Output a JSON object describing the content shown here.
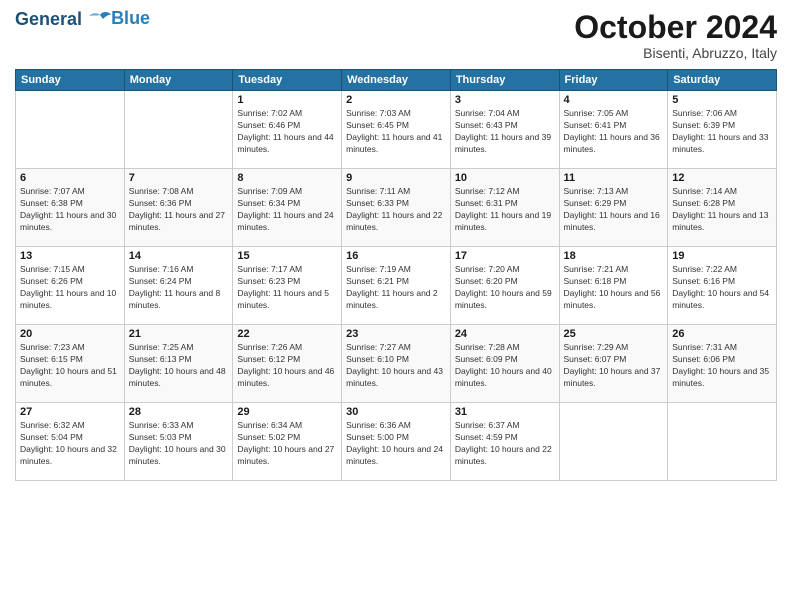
{
  "logo": {
    "line1": "General",
    "line2": "Blue"
  },
  "title": "October 2024",
  "location": "Bisenti, Abruzzo, Italy",
  "days_header": [
    "Sunday",
    "Monday",
    "Tuesday",
    "Wednesday",
    "Thursday",
    "Friday",
    "Saturday"
  ],
  "weeks": [
    [
      {
        "day": "",
        "sunrise": "",
        "sunset": "",
        "daylight": ""
      },
      {
        "day": "",
        "sunrise": "",
        "sunset": "",
        "daylight": ""
      },
      {
        "day": "1",
        "sunrise": "Sunrise: 7:02 AM",
        "sunset": "Sunset: 6:46 PM",
        "daylight": "Daylight: 11 hours and 44 minutes."
      },
      {
        "day": "2",
        "sunrise": "Sunrise: 7:03 AM",
        "sunset": "Sunset: 6:45 PM",
        "daylight": "Daylight: 11 hours and 41 minutes."
      },
      {
        "day": "3",
        "sunrise": "Sunrise: 7:04 AM",
        "sunset": "Sunset: 6:43 PM",
        "daylight": "Daylight: 11 hours and 39 minutes."
      },
      {
        "day": "4",
        "sunrise": "Sunrise: 7:05 AM",
        "sunset": "Sunset: 6:41 PM",
        "daylight": "Daylight: 11 hours and 36 minutes."
      },
      {
        "day": "5",
        "sunrise": "Sunrise: 7:06 AM",
        "sunset": "Sunset: 6:39 PM",
        "daylight": "Daylight: 11 hours and 33 minutes."
      }
    ],
    [
      {
        "day": "6",
        "sunrise": "Sunrise: 7:07 AM",
        "sunset": "Sunset: 6:38 PM",
        "daylight": "Daylight: 11 hours and 30 minutes."
      },
      {
        "day": "7",
        "sunrise": "Sunrise: 7:08 AM",
        "sunset": "Sunset: 6:36 PM",
        "daylight": "Daylight: 11 hours and 27 minutes."
      },
      {
        "day": "8",
        "sunrise": "Sunrise: 7:09 AM",
        "sunset": "Sunset: 6:34 PM",
        "daylight": "Daylight: 11 hours and 24 minutes."
      },
      {
        "day": "9",
        "sunrise": "Sunrise: 7:11 AM",
        "sunset": "Sunset: 6:33 PM",
        "daylight": "Daylight: 11 hours and 22 minutes."
      },
      {
        "day": "10",
        "sunrise": "Sunrise: 7:12 AM",
        "sunset": "Sunset: 6:31 PM",
        "daylight": "Daylight: 11 hours and 19 minutes."
      },
      {
        "day": "11",
        "sunrise": "Sunrise: 7:13 AM",
        "sunset": "Sunset: 6:29 PM",
        "daylight": "Daylight: 11 hours and 16 minutes."
      },
      {
        "day": "12",
        "sunrise": "Sunrise: 7:14 AM",
        "sunset": "Sunset: 6:28 PM",
        "daylight": "Daylight: 11 hours and 13 minutes."
      }
    ],
    [
      {
        "day": "13",
        "sunrise": "Sunrise: 7:15 AM",
        "sunset": "Sunset: 6:26 PM",
        "daylight": "Daylight: 11 hours and 10 minutes."
      },
      {
        "day": "14",
        "sunrise": "Sunrise: 7:16 AM",
        "sunset": "Sunset: 6:24 PM",
        "daylight": "Daylight: 11 hours and 8 minutes."
      },
      {
        "day": "15",
        "sunrise": "Sunrise: 7:17 AM",
        "sunset": "Sunset: 6:23 PM",
        "daylight": "Daylight: 11 hours and 5 minutes."
      },
      {
        "day": "16",
        "sunrise": "Sunrise: 7:19 AM",
        "sunset": "Sunset: 6:21 PM",
        "daylight": "Daylight: 11 hours and 2 minutes."
      },
      {
        "day": "17",
        "sunrise": "Sunrise: 7:20 AM",
        "sunset": "Sunset: 6:20 PM",
        "daylight": "Daylight: 10 hours and 59 minutes."
      },
      {
        "day": "18",
        "sunrise": "Sunrise: 7:21 AM",
        "sunset": "Sunset: 6:18 PM",
        "daylight": "Daylight: 10 hours and 56 minutes."
      },
      {
        "day": "19",
        "sunrise": "Sunrise: 7:22 AM",
        "sunset": "Sunset: 6:16 PM",
        "daylight": "Daylight: 10 hours and 54 minutes."
      }
    ],
    [
      {
        "day": "20",
        "sunrise": "Sunrise: 7:23 AM",
        "sunset": "Sunset: 6:15 PM",
        "daylight": "Daylight: 10 hours and 51 minutes."
      },
      {
        "day": "21",
        "sunrise": "Sunrise: 7:25 AM",
        "sunset": "Sunset: 6:13 PM",
        "daylight": "Daylight: 10 hours and 48 minutes."
      },
      {
        "day": "22",
        "sunrise": "Sunrise: 7:26 AM",
        "sunset": "Sunset: 6:12 PM",
        "daylight": "Daylight: 10 hours and 46 minutes."
      },
      {
        "day": "23",
        "sunrise": "Sunrise: 7:27 AM",
        "sunset": "Sunset: 6:10 PM",
        "daylight": "Daylight: 10 hours and 43 minutes."
      },
      {
        "day": "24",
        "sunrise": "Sunrise: 7:28 AM",
        "sunset": "Sunset: 6:09 PM",
        "daylight": "Daylight: 10 hours and 40 minutes."
      },
      {
        "day": "25",
        "sunrise": "Sunrise: 7:29 AM",
        "sunset": "Sunset: 6:07 PM",
        "daylight": "Daylight: 10 hours and 37 minutes."
      },
      {
        "day": "26",
        "sunrise": "Sunrise: 7:31 AM",
        "sunset": "Sunset: 6:06 PM",
        "daylight": "Daylight: 10 hours and 35 minutes."
      }
    ],
    [
      {
        "day": "27",
        "sunrise": "Sunrise: 6:32 AM",
        "sunset": "Sunset: 5:04 PM",
        "daylight": "Daylight: 10 hours and 32 minutes."
      },
      {
        "day": "28",
        "sunrise": "Sunrise: 6:33 AM",
        "sunset": "Sunset: 5:03 PM",
        "daylight": "Daylight: 10 hours and 30 minutes."
      },
      {
        "day": "29",
        "sunrise": "Sunrise: 6:34 AM",
        "sunset": "Sunset: 5:02 PM",
        "daylight": "Daylight: 10 hours and 27 minutes."
      },
      {
        "day": "30",
        "sunrise": "Sunrise: 6:36 AM",
        "sunset": "Sunset: 5:00 PM",
        "daylight": "Daylight: 10 hours and 24 minutes."
      },
      {
        "day": "31",
        "sunrise": "Sunrise: 6:37 AM",
        "sunset": "Sunset: 4:59 PM",
        "daylight": "Daylight: 10 hours and 22 minutes."
      },
      {
        "day": "",
        "sunrise": "",
        "sunset": "",
        "daylight": ""
      },
      {
        "day": "",
        "sunrise": "",
        "sunset": "",
        "daylight": ""
      }
    ]
  ]
}
